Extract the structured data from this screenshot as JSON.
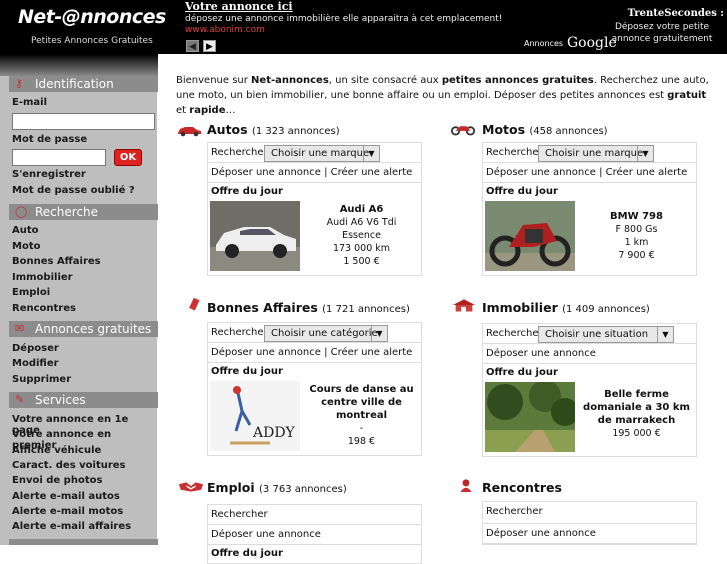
{
  "header": {
    "logo": "Net-@nnonces",
    "tagline": "Petites Annonces Gratuites",
    "ad_title": "Votre annonce ici",
    "ad_text": "déposez une annonce immobilière elle apparaitra à cet emplacement!",
    "ad_url": "www.abonim.com",
    "google_label": "Annonces",
    "google_word": "Google",
    "ts_title": "TrenteSecondes :",
    "ts_text": "Déposez votre petite annonce gratuitement"
  },
  "sidebar": {
    "identification": {
      "title": "Identification",
      "email_label": "E-mail",
      "password_label": "Mot de passe",
      "ok": "OK",
      "register": "S'enregistrer",
      "forgot": "Mot de passe oublié ?"
    },
    "recherche": {
      "title": "Recherche",
      "items": [
        "Auto",
        "Moto",
        "Bonnes Affaires",
        "Immobilier",
        "Emploi",
        "Rencontres"
      ]
    },
    "annonces": {
      "title": "Annonces gratuites",
      "items": [
        "Déposer",
        "Modifier",
        "Supprimer"
      ]
    },
    "services": {
      "title": "Services",
      "items": [
        "Votre annonce en 1e page",
        "Votre annonce en premier",
        "Affiche véhicule",
        "Caract. des voitures",
        "Envoi de photos",
        "Alerte e-mail autos",
        "Alerte e-mail motos",
        "Alerte e-mail affaires"
      ]
    }
  },
  "intro": {
    "p1": "Bienvenue sur ",
    "site": "Net-annonces",
    "p2": ", un site consacré aux ",
    "free_ads": "petites annonces gratuites",
    "p3": ". Recherchez une auto, une moto, un bien immobilier, une bonne affaire ou un emploi. Déposer des petites annonces est ",
    "gratuit": "gratuit",
    "p4": " et ",
    "rapide": "rapide",
    "p5": "…"
  },
  "categories": {
    "autos": {
      "title": "Autos",
      "count": "(1 323 annonces)",
      "search": "Rechercher",
      "select": "Choisir une marque",
      "actions": "Déposer une annonce | Créer une alerte",
      "offer_label": "Offre du jour",
      "offer": [
        "Audi A6",
        "Audi A6 V6 Tdi",
        "Essence",
        "173 000 km",
        "1 500 €"
      ]
    },
    "motos": {
      "title": "Motos",
      "count": "(458 annonces)",
      "search": "Rechercher",
      "select": "Choisir une marque",
      "actions": "Déposer une annonce | Créer une alerte",
      "offer_label": "Offre du jour",
      "offer": [
        "BMW 798",
        "F 800 Gs",
        "1 km",
        "7 900 €"
      ]
    },
    "affaires": {
      "title": "Bonnes Affaires",
      "count": "(1 721 annonces)",
      "search": "Rechercher",
      "select": "Choisir une catégorie",
      "actions": "Déposer une annonce | Créer une alerte",
      "offer_label": "Offre du jour",
      "offer": [
        "Cours de danse au centre ville de montreal",
        "-",
        "198 €"
      ],
      "thumb_text": "ADDY"
    },
    "immobilier": {
      "title": "Immobilier",
      "count": "(1 409 annonces)",
      "search": "Rechercher",
      "select": "Choisir une situation",
      "actions": "Déposer une annonce",
      "offer_label": "Offre du jour",
      "offer": [
        "Belle ferme domaniale a 30 km de marrakech",
        "195 000 €"
      ]
    },
    "emploi": {
      "title": "Emploi",
      "count": "(3 763 annonces)",
      "search": "Rechercher",
      "actions": "Déposer une annonce",
      "offer_label": "Offre du jour"
    },
    "rencontres": {
      "title": "Rencontres",
      "search": "Rechercher",
      "actions": "Déposer une annonce"
    }
  }
}
